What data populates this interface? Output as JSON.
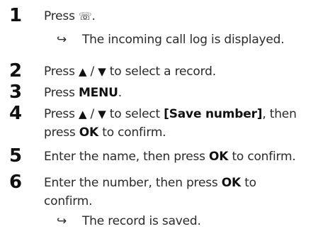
{
  "steps": [
    {
      "number": "1",
      "pre": "Press ",
      "icon_glyph": "☏",
      "icon": "call-log-icon",
      "post": ".",
      "result_arrow": "↪",
      "result": "The incoming call log is displayed."
    },
    {
      "number": "2",
      "pre": "Press ",
      "up": "▲",
      "slash": " / ",
      "down": "▼",
      "post": " to select a record."
    },
    {
      "number": "3",
      "pre": "Press ",
      "key": "MENU",
      "post": "."
    },
    {
      "number": "4",
      "pre": "Press ",
      "up": "▲",
      "slash": " / ",
      "down": "▼",
      "mid": " to select ",
      "option": "[Save number]",
      "post": ", then",
      "line2_pre": "press ",
      "key": "OK",
      "line2_post": " to confirm."
    },
    {
      "number": "5",
      "pre": "Enter the name, then press ",
      "key": "OK",
      "post": " to confirm."
    },
    {
      "number": "6",
      "pre": "Enter the number, then press ",
      "key": "OK",
      "post": " to",
      "line2": "confirm.",
      "result_arrow": "↪",
      "result": "The record is saved."
    }
  ]
}
